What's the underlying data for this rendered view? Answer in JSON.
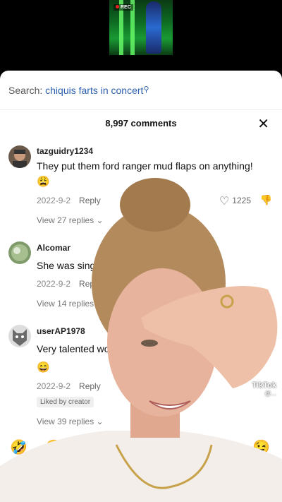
{
  "video": {
    "rec_label": "REC"
  },
  "search": {
    "prefix": "Search:",
    "query": "chiquis farts in concert"
  },
  "header": {
    "count": "8,997 comments"
  },
  "comments": [
    {
      "user": "tazguidry1234",
      "text": "They put them ford ranger mud flaps on anything!",
      "emoji": "😩",
      "date": "2022-9-2",
      "reply": "Reply",
      "likes": "1225",
      "view_replies": "View 27 replies"
    },
    {
      "user": "Alcomar",
      "text": "She was singing",
      "date": "2022-9-2",
      "reply": "Reply",
      "view_replies": "View 14 replies"
    },
    {
      "user": "userAP1978",
      "text": "Very talented wo",
      "emoji": "😄",
      "date": "2022-9-2",
      "reply": "Reply",
      "badge": "Liked by creator",
      "view_replies": "View 39 replies"
    }
  ],
  "emoji_bar": [
    "🤣",
    "😍",
    "😉"
  ],
  "watermark": {
    "brand": "TikTok",
    "handle": "@..."
  }
}
